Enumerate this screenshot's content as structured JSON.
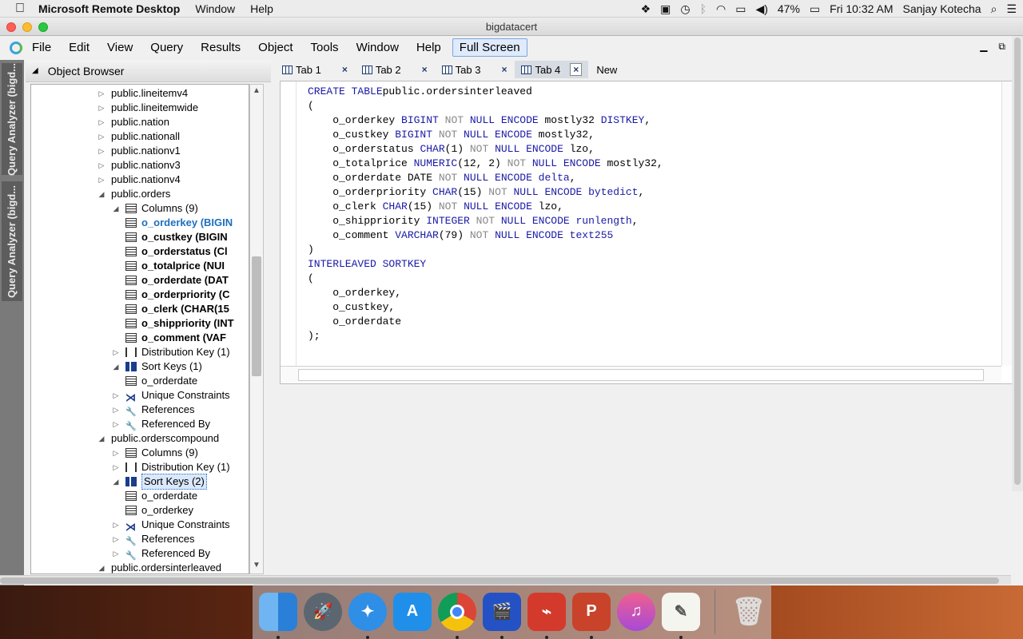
{
  "mac_menubar": {
    "app_name": "Microsoft Remote Desktop",
    "menus": [
      "Window",
      "Help"
    ],
    "battery": "47%",
    "clock": "Fri 10:32 AM",
    "user": "Sanjay Kotecha"
  },
  "window": {
    "title": "bigdatacert"
  },
  "app_menu": {
    "items": [
      "File",
      "Edit",
      "View",
      "Query",
      "Results",
      "Object",
      "Tools",
      "Window",
      "Help"
    ],
    "full_screen": "Full Screen"
  },
  "side_tabs": [
    "Query Analyzer (bigd...",
    "Query Analyzer (bigd..."
  ],
  "object_browser": {
    "title": "Object Browser",
    "nodes": [
      {
        "label": "public.lineitemv4",
        "indent": 0,
        "exp": "▷",
        "icon": "none"
      },
      {
        "label": "public.lineitemwide",
        "indent": 0,
        "exp": "▷",
        "icon": "none"
      },
      {
        "label": "public.nation",
        "indent": 0,
        "exp": "▷",
        "icon": "none"
      },
      {
        "label": "public.nationall",
        "indent": 0,
        "exp": "▷",
        "icon": "none"
      },
      {
        "label": "public.nationv1",
        "indent": 0,
        "exp": "▷",
        "icon": "none"
      },
      {
        "label": "public.nationv3",
        "indent": 0,
        "exp": "▷",
        "icon": "none"
      },
      {
        "label": "public.nationv4",
        "indent": 0,
        "exp": "▷",
        "icon": "none"
      },
      {
        "label": "public.orders",
        "indent": 0,
        "exp": "◢",
        "icon": "none"
      },
      {
        "label": "Columns (9)",
        "indent": 1,
        "exp": "◢",
        "icon": "table"
      },
      {
        "label": "o_orderkey (BIGIN",
        "indent": 2,
        "exp": "",
        "icon": "table",
        "style": "bold sel"
      },
      {
        "label": "o_custkey (BIGIN",
        "indent": 2,
        "exp": "",
        "icon": "table",
        "style": "bold"
      },
      {
        "label": "o_orderstatus (Cl",
        "indent": 2,
        "exp": "",
        "icon": "table",
        "style": "bold"
      },
      {
        "label": "o_totalprice (NUI",
        "indent": 2,
        "exp": "",
        "icon": "table",
        "style": "bold"
      },
      {
        "label": "o_orderdate (DAT",
        "indent": 2,
        "exp": "",
        "icon": "table",
        "style": "bold"
      },
      {
        "label": "o_orderpriority (C",
        "indent": 2,
        "exp": "",
        "icon": "table",
        "style": "bold"
      },
      {
        "label": "o_clerk (CHAR(15",
        "indent": 2,
        "exp": "",
        "icon": "table",
        "style": "bold"
      },
      {
        "label": "o_shippriority (INT",
        "indent": 2,
        "exp": "",
        "icon": "table",
        "style": "bold"
      },
      {
        "label": "o_comment (VAF",
        "indent": 2,
        "exp": "",
        "icon": "table",
        "style": "bold"
      },
      {
        "label": "Distribution Key (1)",
        "indent": 1,
        "exp": "▷",
        "icon": "dist"
      },
      {
        "label": "Sort Keys (1)",
        "indent": 1,
        "exp": "◢",
        "icon": "sort"
      },
      {
        "label": "o_orderdate",
        "indent": 2,
        "exp": "",
        "icon": "table"
      },
      {
        "label": "Unique Constraints",
        "indent": 1,
        "exp": "▷",
        "icon": "uc"
      },
      {
        "label": "References",
        "indent": 1,
        "exp": "▷",
        "icon": "key"
      },
      {
        "label": "Referenced By",
        "indent": 1,
        "exp": "▷",
        "icon": "key"
      },
      {
        "label": "public.orderscompound",
        "indent": 0,
        "exp": "◢",
        "icon": "none"
      },
      {
        "label": "Columns (9)",
        "indent": 1,
        "exp": "▷",
        "icon": "table"
      },
      {
        "label": "Distribution Key (1)",
        "indent": 1,
        "exp": "▷",
        "icon": "dist"
      },
      {
        "label": "Sort Keys (2)",
        "indent": 1,
        "exp": "◢",
        "icon": "sort",
        "style": "box"
      },
      {
        "label": "o_orderdate",
        "indent": 2,
        "exp": "",
        "icon": "table"
      },
      {
        "label": "o_orderkey",
        "indent": 2,
        "exp": "",
        "icon": "table"
      },
      {
        "label": "Unique Constraints",
        "indent": 1,
        "exp": "▷",
        "icon": "uc"
      },
      {
        "label": "References",
        "indent": 1,
        "exp": "▷",
        "icon": "key"
      },
      {
        "label": "Referenced By",
        "indent": 1,
        "exp": "▷",
        "icon": "key"
      },
      {
        "label": "public.ordersinterleaved",
        "indent": 0,
        "exp": "◢",
        "icon": "none"
      }
    ]
  },
  "tabs": [
    {
      "label": "Tab 1",
      "close": "×"
    },
    {
      "label": "Tab 2",
      "close": "×"
    },
    {
      "label": "Tab 3",
      "close": "×"
    },
    {
      "label": "Tab 4",
      "close": "×",
      "active": true
    },
    {
      "label": "New",
      "close": ""
    }
  ],
  "sql_lines": [
    [
      [
        "kw",
        "CREATE TABLE"
      ],
      [
        "",
        "public.ordersinterleaved"
      ]
    ],
    [
      [
        "",
        "("
      ]
    ],
    [
      [
        "",
        "    o_orderkey "
      ],
      [
        "kw",
        "BIGINT"
      ],
      [
        "gr",
        " NOT"
      ],
      [
        "kw",
        " NULL ENCODE"
      ],
      [
        "",
        " mostly32 "
      ],
      [
        "kw",
        "DISTKEY"
      ],
      [
        "",
        ","
      ]
    ],
    [
      [
        "",
        "    o_custkey "
      ],
      [
        "kw",
        "BIGINT"
      ],
      [
        "gr",
        " NOT"
      ],
      [
        "kw",
        " NULL ENCODE"
      ],
      [
        "",
        " mostly32,"
      ]
    ],
    [
      [
        "",
        "    o_orderstatus "
      ],
      [
        "kw",
        "CHAR"
      ],
      [
        "",
        "(1)"
      ],
      [
        "gr",
        " NOT"
      ],
      [
        "kw",
        " NULL ENCODE"
      ],
      [
        "",
        " lzo,"
      ]
    ],
    [
      [
        "",
        "    o_totalprice "
      ],
      [
        "kw",
        "NUMERIC"
      ],
      [
        "",
        "(12, 2)"
      ],
      [
        "gr",
        " NOT"
      ],
      [
        "kw",
        " NULL ENCODE"
      ],
      [
        "",
        " mostly32,"
      ]
    ],
    [
      [
        "",
        "    o_orderdate DATE"
      ],
      [
        "gr",
        " NOT"
      ],
      [
        "kw",
        " NULL ENCODE delta"
      ],
      [
        "",
        ","
      ]
    ],
    [
      [
        "",
        "    o_orderpriority "
      ],
      [
        "kw",
        "CHAR"
      ],
      [
        "",
        "(15)"
      ],
      [
        "gr",
        " NOT"
      ],
      [
        "kw",
        " NULL ENCODE bytedict"
      ],
      [
        "",
        ","
      ]
    ],
    [
      [
        "",
        "    o_clerk "
      ],
      [
        "kw",
        "CHAR"
      ],
      [
        "",
        "(15)"
      ],
      [
        "gr",
        " NOT"
      ],
      [
        "kw",
        " NULL ENCODE"
      ],
      [
        "",
        " lzo,"
      ]
    ],
    [
      [
        "",
        "    o_shippriority "
      ],
      [
        "kw",
        "INTEGER"
      ],
      [
        "gr",
        " NOT"
      ],
      [
        "kw",
        " NULL ENCODE runlength"
      ],
      [
        "",
        ","
      ]
    ],
    [
      [
        "",
        "    o_comment "
      ],
      [
        "kw",
        "VARCHAR"
      ],
      [
        "",
        "(79)"
      ],
      [
        "gr",
        " NOT"
      ],
      [
        "kw",
        " NULL ENCODE text255"
      ]
    ],
    [
      [
        "",
        ")"
      ]
    ],
    [
      [
        "kw",
        "INTERLEAVED SORTKEY"
      ]
    ],
    [
      [
        "",
        "("
      ]
    ],
    [
      [
        "",
        "    o_orderkey,"
      ]
    ],
    [
      [
        "",
        "    o_custkey,"
      ]
    ],
    [
      [
        "",
        "    o_orderdate"
      ]
    ],
    [
      [
        "",
        ");"
      ]
    ]
  ],
  "colors": {
    "keyword": "#1a1aa6",
    "not": "#888888",
    "accent": "#1e6fbf"
  }
}
